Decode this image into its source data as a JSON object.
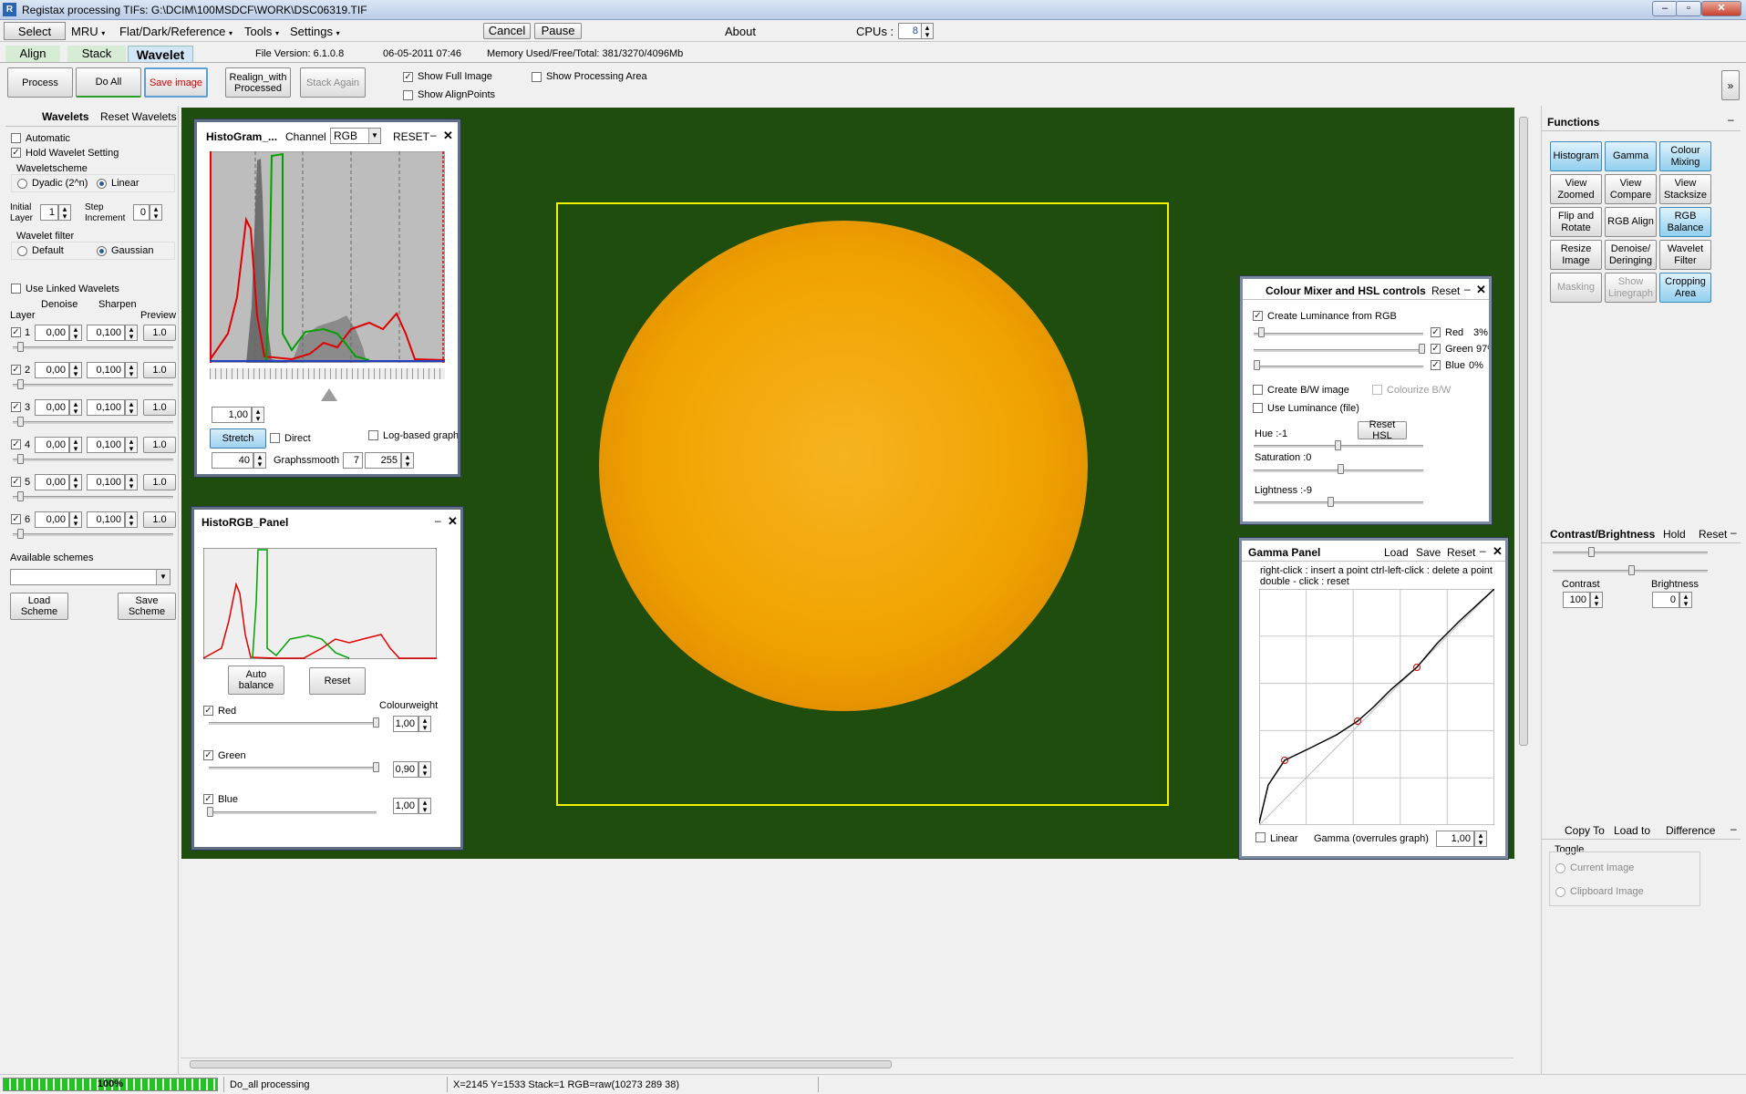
{
  "window": {
    "title": "Registax processing TIFs: G:\\DCIM\\100MSDCF\\WORK\\DSC06319.TIF",
    "app_icon": "R"
  },
  "menubar": {
    "select": "Select",
    "mru": "MRU",
    "flat": "Flat/Dark/Reference",
    "tools": "Tools",
    "settings": "Settings",
    "cancel": "Cancel",
    "pause": "Pause",
    "about": "About",
    "cpus_label": "CPUs :",
    "cpus_value": "8"
  },
  "tabs": {
    "align": "Align",
    "stack": "Stack",
    "wavelet": "Wavelet"
  },
  "info": {
    "file_version": "File Version: 6.1.0.8",
    "datetime": "06-05-2011 07:46",
    "memory": "Memory Used/Free/Total: 381/3270/4096Mb"
  },
  "toolbar": {
    "process": "Process",
    "do_all": "Do All",
    "save_image": "Save image",
    "realign": "Realign_with Processed",
    "stack_again": "Stack Again",
    "show_full_image": "Show Full Image",
    "show_align_points": "Show AlignPoints",
    "show_processing_area": "Show Processing Area"
  },
  "wavelets": {
    "title": "Wavelets",
    "reset": "Reset Wavelets",
    "automatic": "Automatic",
    "hold": "Hold Wavelet Setting",
    "scheme_label": "Waveletscheme",
    "dyadic": "Dyadic (2^n)",
    "linear": "Linear",
    "initial_layer": "Initial Layer",
    "initial_layer_value": "1",
    "step_increment": "Step Increment",
    "step_value": "0",
    "filter_label": "Wavelet filter",
    "default": "Default",
    "gaussian": "Gaussian",
    "use_linked": "Use Linked Wavelets",
    "denoise": "Denoise",
    "sharpen": "Sharpen",
    "layer": "Layer",
    "preview": "Preview",
    "layers": [
      {
        "n": "1",
        "denoise": "0,00",
        "sharpen": "0,100",
        "preview": "1.0"
      },
      {
        "n": "2",
        "denoise": "0,00",
        "sharpen": "0,100",
        "preview": "1.0"
      },
      {
        "n": "3",
        "denoise": "0,00",
        "sharpen": "0,100",
        "preview": "1.0"
      },
      {
        "n": "4",
        "denoise": "0,00",
        "sharpen": "0,100",
        "preview": "1.0"
      },
      {
        "n": "5",
        "denoise": "0,00",
        "sharpen": "0,100",
        "preview": "1.0"
      },
      {
        "n": "6",
        "denoise": "0,00",
        "sharpen": "0,100",
        "preview": "1.0"
      }
    ],
    "available_schemes": "Available schemes",
    "load_scheme": "Load Scheme",
    "save_scheme": "Save Scheme"
  },
  "histogram": {
    "title": "HistoGram_...",
    "channel_label": "Channel",
    "channel_value": "RGB",
    "reset": "RESET",
    "value": "1,00",
    "stretch": "Stretch",
    "direct": "Direct",
    "log_based": "Log-based graph",
    "left_value": "40",
    "graphsmooth": "Graphssmooth",
    "smooth_value": "7",
    "right_value": "255"
  },
  "histo_rgb": {
    "title": "HistoRGB_Panel",
    "auto_balance": "Auto balance",
    "reset": "Reset",
    "colourweight": "Colourweight",
    "red": "Red",
    "red_value": "1,00",
    "green": "Green",
    "green_value": "0,90",
    "blue": "Blue",
    "blue_value": "1,00"
  },
  "colour_mixer": {
    "title": "Colour Mixer and HSL controls",
    "reset": "Reset",
    "create_luminance": "Create Luminance from RGB",
    "red": "Red",
    "red_pct": "3%",
    "green": "Green",
    "green_pct": "97%",
    "blue": "Blue",
    "blue_pct": "0%",
    "create_bw": "Create B/W image",
    "colorize_bw": "Colourize B/W",
    "use_luminance": "Use Luminance (file)",
    "hue": "Hue :-1",
    "reset_hsl": "Reset HSL",
    "saturation": "Saturation :0",
    "lightness": "Lightness :-9"
  },
  "gamma_panel": {
    "title": "Gamma Panel",
    "load": "Load",
    "save": "Save",
    "reset": "Reset",
    "hint1": "right-click : insert a point   ctrl-left-click : delete a point",
    "hint2": "double - click : reset",
    "linear": "Linear",
    "gamma_label": "Gamma (overrules graph)",
    "gamma_value": "1,00"
  },
  "functions": {
    "title": "Functions",
    "buttons": [
      {
        "label": "Histogram",
        "state": "on"
      },
      {
        "label": "Gamma",
        "state": "on"
      },
      {
        "label": "Colour Mixing",
        "state": "on"
      },
      {
        "label": "View Zoomed",
        "state": "off"
      },
      {
        "label": "View Compare",
        "state": "off"
      },
      {
        "label": "View Stacksize",
        "state": "off"
      },
      {
        "label": "Flip and Rotate",
        "state": "off"
      },
      {
        "label": "RGB Align",
        "state": "off"
      },
      {
        "label": "RGB Balance",
        "state": "on"
      },
      {
        "label": "Resize Image",
        "state": "off"
      },
      {
        "label": "Denoise/ Deringing",
        "state": "off"
      },
      {
        "label": "Wavelet Filter",
        "state": "off"
      },
      {
        "label": "Masking",
        "state": "dis"
      },
      {
        "label": "Show Linegraph",
        "state": "dis"
      },
      {
        "label": "Cropping Area",
        "state": "on"
      }
    ]
  },
  "contrast": {
    "title": "Contrast/Brightness",
    "hold": "Hold",
    "reset": "Reset",
    "contrast": "Contrast",
    "contrast_value": "100",
    "brightness": "Brightness",
    "brightness_value": "0"
  },
  "copy": {
    "copy_to": "Copy To",
    "load_to": "Load to",
    "difference": "Difference",
    "toggle": "Toggle",
    "current_image": "Current Image",
    "clipboard_image": "Clipboard Image"
  },
  "status": {
    "progress_text": "100%",
    "progress": 1.0,
    "message": "Do_all processing",
    "coords": "X=2145 Y=1533 Stack=1 RGB=raw(10273 289 38)"
  },
  "colors": {
    "canvas_bg": "#1e4d0e",
    "sun": "#f0a800",
    "crop": "#f2f200",
    "red": "#e00000",
    "green": "#009a00"
  }
}
